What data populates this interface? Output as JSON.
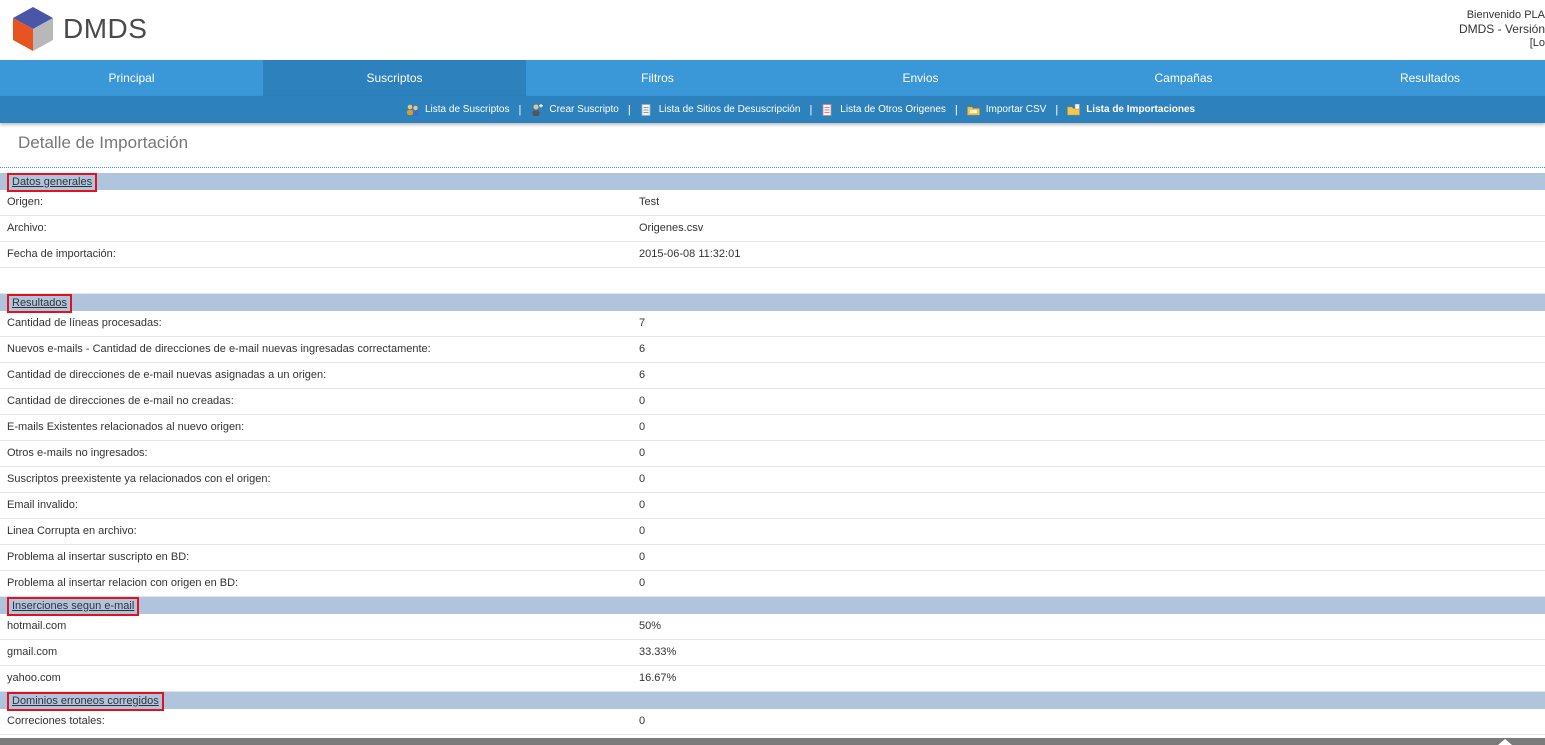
{
  "app": {
    "name": "DMDS"
  },
  "user": {
    "welcome": "Bienvenido PLA",
    "version": "DMDS - Versión",
    "logout": "[Lo"
  },
  "main_nav": [
    {
      "label": "Principal"
    },
    {
      "label": "Suscriptos",
      "active": true
    },
    {
      "label": "Filtros"
    },
    {
      "label": "Envios"
    },
    {
      "label": "Campañas"
    },
    {
      "label": "Resultados"
    }
  ],
  "sub_nav": [
    {
      "label": "Lista de Suscriptos",
      "icon": "users-icon"
    },
    {
      "label": "Crear Suscripto",
      "icon": "add-user-icon"
    },
    {
      "label": "Lista de Sitios de Desuscripción",
      "icon": "document-icon"
    },
    {
      "label": "Lista de Otros Origenes",
      "icon": "document-icon"
    },
    {
      "label": "Importar CSV",
      "icon": "folder-icon"
    },
    {
      "label": "Lista de Importaciones",
      "icon": "folder-list-icon",
      "active": true
    }
  ],
  "page": {
    "title": "Detalle de Importación"
  },
  "sections": {
    "general": {
      "title": "Datos generales",
      "rows": [
        {
          "label": "Origen:",
          "value": "Test"
        },
        {
          "label": "Archivo:",
          "value": "Origenes.csv"
        },
        {
          "label": "Fecha de importación:",
          "value": "2015-06-08 11:32:01"
        }
      ]
    },
    "results": {
      "title": "Resultados",
      "rows": [
        {
          "label": "Cantidad de líneas procesadas:",
          "value": "7"
        },
        {
          "label": "Nuevos e-mails - Cantidad de direcciones de e-mail nuevas ingresadas correctamente:",
          "value": "6"
        },
        {
          "label": "Cantidad de direcciones de e-mail nuevas asignadas a un origen:",
          "value": "6"
        },
        {
          "label": "Cantidad de direcciones de e-mail no creadas:",
          "value": "0"
        },
        {
          "label": "E-mails Existentes relacionados al nuevo origen:",
          "value": "0"
        },
        {
          "label": "Otros e-mails no ingresados:",
          "value": "0"
        },
        {
          "label": "Suscriptos preexistente ya relacionados con el origen:",
          "value": "0"
        },
        {
          "label": "Email invalido:",
          "value": "0"
        },
        {
          "label": "Linea Corrupta en archivo:",
          "value": "0"
        },
        {
          "label": "Problema al insertar suscripto en BD:",
          "value": "0"
        },
        {
          "label": "Problema al insertar relacion con origen en BD:",
          "value": "0"
        }
      ]
    },
    "by_email": {
      "title": "Inserciones segun e-mail",
      "rows": [
        {
          "label": "hotmail.com",
          "value": "50%"
        },
        {
          "label": "gmail.com",
          "value": "33.33%"
        },
        {
          "label": "yahoo.com",
          "value": "16.67%"
        }
      ]
    },
    "domains": {
      "title": "Dominios erroneos corregidos",
      "rows": [
        {
          "label": "Correciones totales:",
          "value": "0"
        }
      ]
    }
  },
  "colors": {
    "nav": "#3a97d8",
    "nav_active": "#2d81bd",
    "section_header": "#b0c4de",
    "highlight_box": "#e0121b"
  }
}
